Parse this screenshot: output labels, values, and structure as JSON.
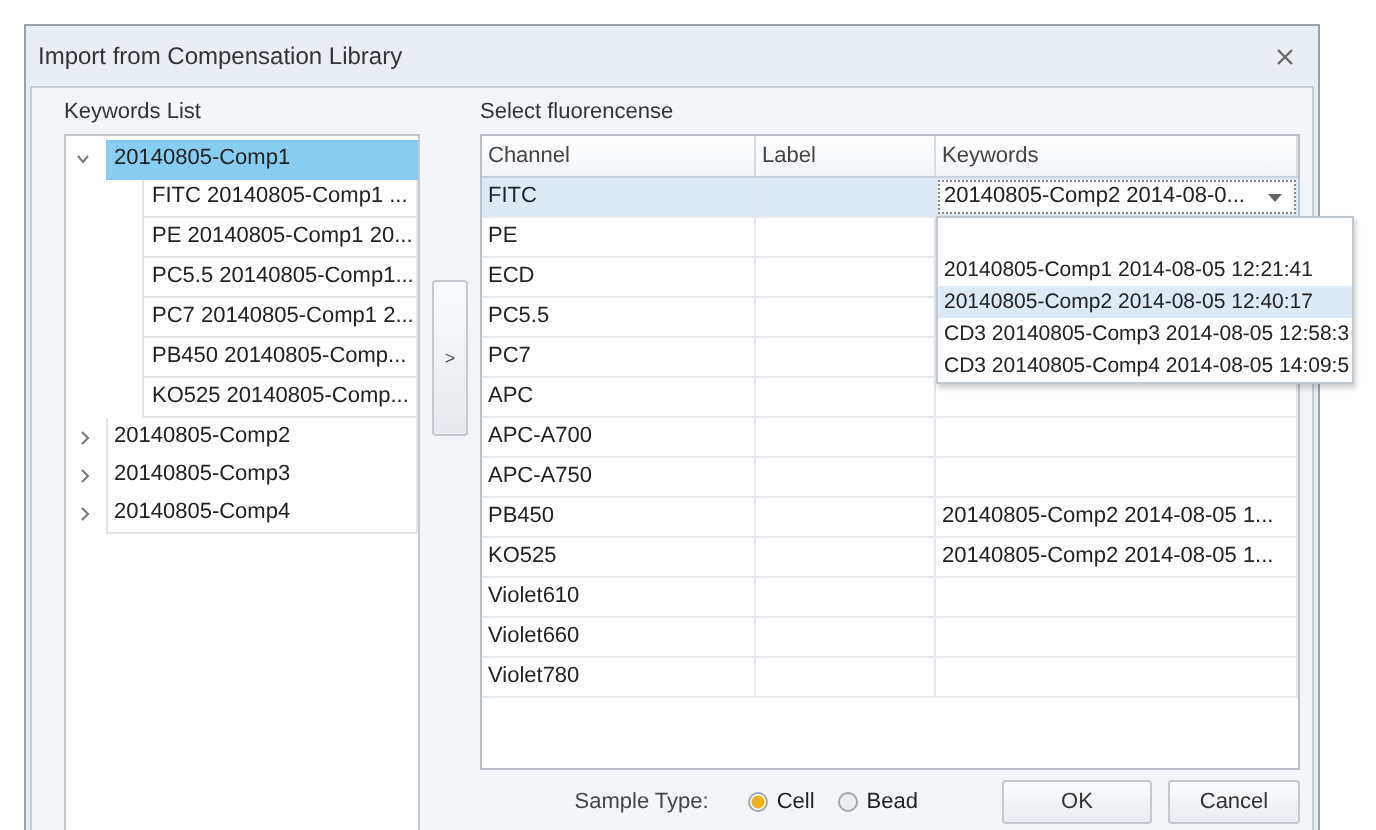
{
  "window": {
    "title": "Import from Compensation Library"
  },
  "keywords_list": {
    "title": "Keywords List",
    "items": [
      {
        "label": "20140805-Comp1",
        "expanded": true,
        "selected": true,
        "children": [
          {
            "label": "FITC 20140805-Comp1 ...",
            "selected": false
          },
          {
            "label": "PE 20140805-Comp1 20...",
            "selected": false
          },
          {
            "label": "PC5.5 20140805-Comp1...",
            "selected": false
          },
          {
            "label": "PC7 20140805-Comp1 2...",
            "selected": false
          },
          {
            "label": "PB450 20140805-Comp...",
            "selected": false
          },
          {
            "label": "KO525 20140805-Comp...",
            "selected": false
          }
        ]
      },
      {
        "label": "20140805-Comp2",
        "expanded": false,
        "selected": false
      },
      {
        "label": "20140805-Comp3",
        "expanded": false,
        "selected": false
      },
      {
        "label": "20140805-Comp4",
        "expanded": false,
        "selected": false
      }
    ]
  },
  "move_button": {
    "label": ">"
  },
  "fluorescence": {
    "title": "Select fluorencense",
    "columns": [
      "Channel",
      "Label",
      "Keywords"
    ],
    "rows": [
      {
        "channel": "FITC",
        "label": "",
        "keywords": "20140805-Comp2 2014-08-0...",
        "selected": true,
        "kind": "dropdown",
        "options": [
          {
            "label": "20140805-Comp1 2014-08-05 12:21:41",
            "selected": false
          },
          {
            "label": "20140805-Comp2 2014-08-05 12:40:17",
            "selected": true
          },
          {
            "label": "CD3 20140805-Comp3 2014-08-05 12:58:3",
            "selected": false
          },
          {
            "label": "CD3 20140805-Comp4 2014-08-05 14:09:5",
            "selected": false
          }
        ]
      },
      {
        "channel": "PE",
        "keywords": "",
        "selected": false,
        "kind": "text"
      },
      {
        "channel": "ECD",
        "keywords": "",
        "selected": false,
        "kind": "text"
      },
      {
        "channel": "PC5.5",
        "keywords": "",
        "selected": false,
        "kind": "text"
      },
      {
        "channel": "PC7",
        "keywords": "",
        "selected": false,
        "kind": "text"
      },
      {
        "channel": "APC",
        "keywords": "",
        "selected": false,
        "kind": "text"
      },
      {
        "channel": "APC-A700",
        "keywords": "",
        "selected": false,
        "kind": "text"
      },
      {
        "channel": "APC-A750",
        "keywords": "",
        "selected": false,
        "kind": "text"
      },
      {
        "channel": "PB450",
        "keywords": "20140805-Comp2 2014-08-05 1...",
        "selected": false,
        "kind": "text"
      },
      {
        "channel": "KO525",
        "keywords": "20140805-Comp2 2014-08-05 1...",
        "selected": false,
        "kind": "text"
      },
      {
        "channel": "Violet610",
        "keywords": "",
        "selected": false,
        "kind": "text"
      },
      {
        "channel": "Violet660",
        "keywords": "",
        "selected": false,
        "kind": "text"
      },
      {
        "channel": "Violet780",
        "keywords": "",
        "selected": false,
        "kind": "text"
      }
    ]
  },
  "sample_type": {
    "label": "Sample Type:",
    "options": [
      {
        "label": "Cell",
        "selected": true
      },
      {
        "label": "Bead",
        "selected": false
      }
    ]
  },
  "buttons": [
    "OK",
    "Cancel"
  ]
}
